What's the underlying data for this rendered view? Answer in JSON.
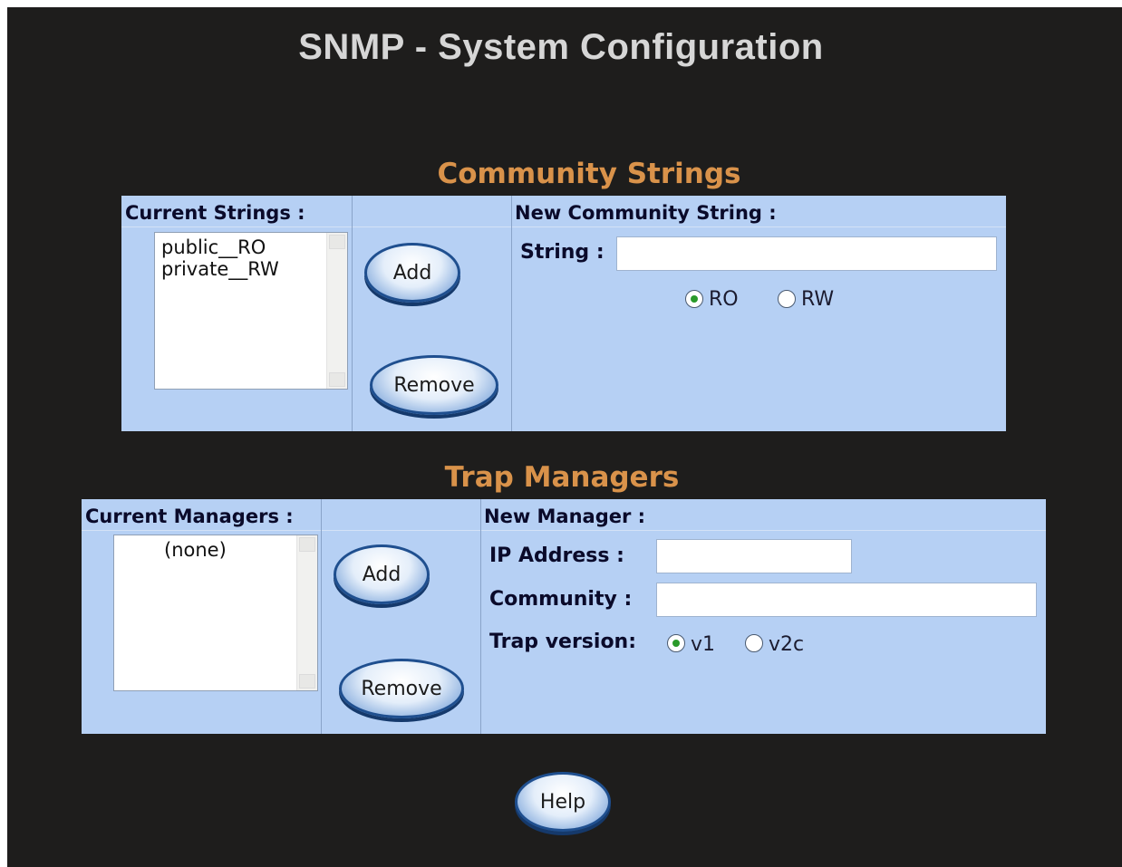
{
  "page": {
    "title": "SNMP - System Configuration"
  },
  "community": {
    "title": "Community Strings",
    "current_header": "Current Strings :",
    "new_header": "New Community String :",
    "items": [
      "public__RO",
      "private__RW"
    ],
    "add_label": "Add",
    "remove_label": "Remove",
    "string_label": "String :",
    "string_value": "",
    "access_options": [
      "RO",
      "RW"
    ],
    "access_selected": "RO"
  },
  "trap": {
    "title": "Trap Managers",
    "current_header": "Current Managers :",
    "new_header": "New Manager :",
    "items": [
      "(none)"
    ],
    "add_label": "Add",
    "remove_label": "Remove",
    "ip_label": "IP Address :",
    "ip_value": "",
    "community_label": "Community :",
    "community_value": "",
    "version_label": "Trap version:",
    "version_options": [
      "v1",
      "v2c"
    ],
    "version_selected": "v1"
  },
  "help_label": "Help",
  "colors": {
    "background": "#1e1d1c",
    "panel": "#b6d0f4",
    "section_title": "#d9924a",
    "page_title": "#d6d6d6"
  }
}
